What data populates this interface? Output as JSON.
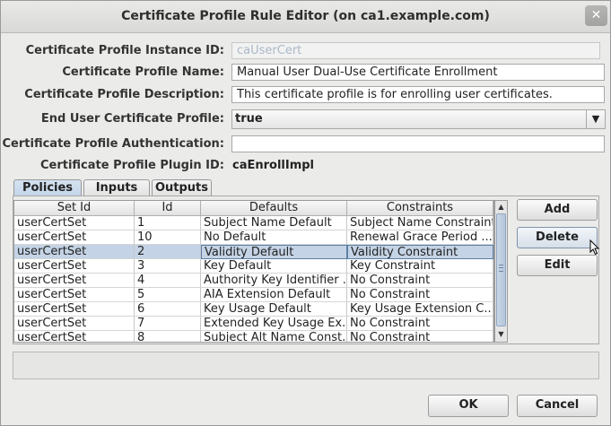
{
  "window": {
    "title": "Certificate Profile Rule Editor (on ca1.example.com)",
    "close_label": "✕"
  },
  "form": {
    "instance_id": {
      "label": "Certificate Profile Instance ID:",
      "value": "caUserCert"
    },
    "name": {
      "label": "Certificate Profile Name:",
      "value": "Manual User Dual-Use Certificate Enrollment"
    },
    "description": {
      "label": "Certificate Profile Description:",
      "value": "This certificate profile is for enrolling user certificates."
    },
    "end_user": {
      "label": "End User Certificate Profile:",
      "value": "true"
    },
    "authentication": {
      "label": "Certificate Profile Authentication:",
      "value": ""
    },
    "plugin": {
      "label": "Certificate Profile Plugin ID:",
      "value": "caEnrollImpl"
    }
  },
  "tabs": [
    {
      "label": "Policies",
      "active": true
    },
    {
      "label": "Inputs",
      "active": false
    },
    {
      "label": "Outputs",
      "active": false
    }
  ],
  "table": {
    "columns": [
      "Set Id",
      "Id",
      "Defaults",
      "Constraints"
    ],
    "rows": [
      [
        "userCertSet",
        "1",
        "Subject Name Default",
        "Subject Name Constraint"
      ],
      [
        "userCertSet",
        "10",
        "No Default",
        "Renewal Grace Period ..."
      ],
      [
        "userCertSet",
        "2",
        "Validity Default",
        "Validity Constraint"
      ],
      [
        "userCertSet",
        "3",
        "Key Default",
        "Key Constraint"
      ],
      [
        "userCertSet",
        "4",
        "Authority Key Identifier ...",
        "No Constraint"
      ],
      [
        "userCertSet",
        "5",
        "AIA Extension Default",
        "No Constraint"
      ],
      [
        "userCertSet",
        "6",
        "Key Usage Default",
        "Key Usage Extension C..."
      ],
      [
        "userCertSet",
        "7",
        "Extended Key Usage Ex...",
        "No Constraint"
      ],
      [
        "userCertSet",
        "8",
        "Subject Alt Name Const...",
        "No Constraint"
      ]
    ],
    "selected_row": 2
  },
  "side_buttons": {
    "add": "Add",
    "delete": "Delete",
    "edit": "Edit"
  },
  "footer": {
    "ok": "OK",
    "cancel": "Cancel"
  },
  "icons": {
    "close": "close-icon",
    "dropdown": "chevron-down-icon",
    "scroll_up": "arrow-up-icon",
    "scroll_down": "arrow-down-icon"
  }
}
